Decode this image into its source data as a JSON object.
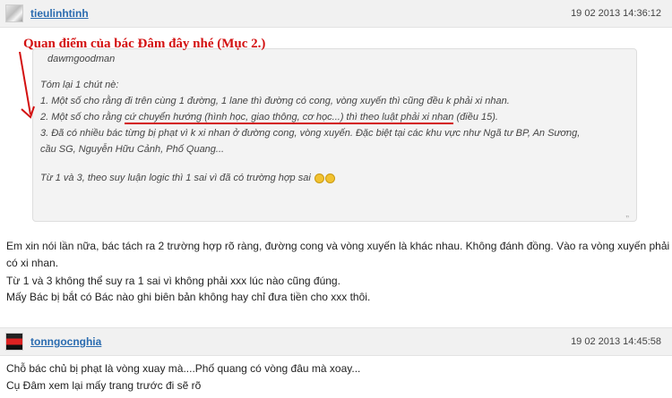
{
  "posts": [
    {
      "username": "tieulinhtinh",
      "timestamp": "19 02 2013 14:36:12",
      "annotation": "Quan điểm của bác Đâm đây nhé (Mục 2.)",
      "quote": {
        "author": "dawmgoodman",
        "lines": [
          "Tóm lại 1 chút nè:",
          "1. Một số cho rằng đi trên cùng 1 đường, 1 lane thì đường có cong, vòng xuyến thì cũng đều k phải xi nhan.",
          "3. Đã có nhiều bác từng bị phạt vì k xi nhan ở đường cong, vòng xuyến. Đặc biệt tại các khu vực như Ngã tư BP, An Sương,",
          "cầu SG, Nguyễn Hữu Cảnh, Phố Quang...",
          "Từ 1 và 3, theo suy luận logic thì 1 sai vì đã có trường hợp sai"
        ],
        "line2_pre": "2. Một số cho rằng ",
        "line2_hl": "cứ chuyển hướng (hình học, giao thông, cơ học...) thì theo luật phải xi nhan",
        "line2_post": " (điều 15)."
      },
      "body": [
        "Em xin nói lần nữa, bác tách ra 2 trường hợp rõ ràng, đường cong và vòng xuyến là khác nhau. Không đánh đồng. Vào ra vòng xuyến phải",
        "có xi nhan.",
        "Từ 1 và 3 không thể suy ra 1 sai vì không phải xxx lúc nào cũng đúng.",
        "Mấy Bác bị bắt có Bác nào ghi biên bản không hay chỉ đưa tiền cho xxx thôi."
      ]
    },
    {
      "username": "tonngocnghia",
      "timestamp": "19 02 2013 14:45:58",
      "body": [
        "Chỗ bác chủ bị phạt là vòng xuay mà....Phố quang có vòng đâu mà xoay...",
        "Cụ Đâm xem lại mấy trang trước đi sẽ rõ"
      ]
    }
  ],
  "colors": {
    "link": "#2b6cb0",
    "annotation": "#d31010",
    "quote_bg": "#f3f3f3",
    "header_bg": "#f1f1f1"
  },
  "icons": {
    "avatar_1": "user-avatar",
    "avatar_2": "flag-avatar",
    "emoji": "laughing-emoji-icon"
  }
}
